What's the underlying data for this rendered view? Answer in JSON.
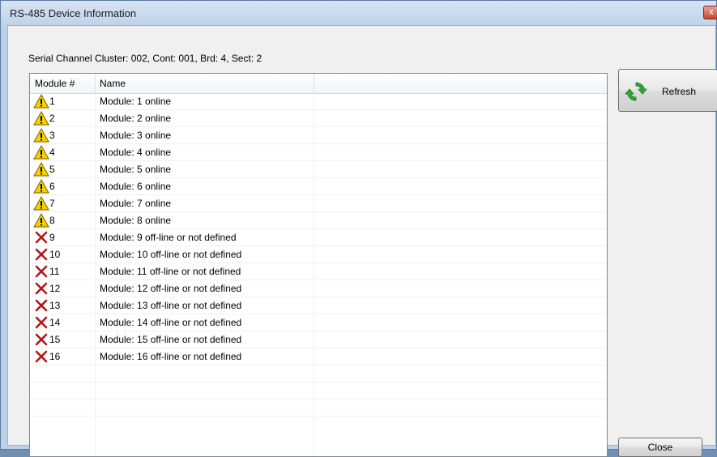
{
  "window": {
    "title": "RS-485 Device Information",
    "close_glyph": "x"
  },
  "info": {
    "label": "Serial Channel Cluster: 002, Cont: 001, Brd: 4, Sect: 2"
  },
  "table": {
    "columns": [
      "Module #",
      "Name"
    ],
    "rows": [
      {
        "status": "warning-icon",
        "num": "1",
        "name": "Module: 1 online"
      },
      {
        "status": "warning-icon",
        "num": "2",
        "name": "Module: 2 online"
      },
      {
        "status": "warning-icon",
        "num": "3",
        "name": "Module: 3 online"
      },
      {
        "status": "warning-icon",
        "num": "4",
        "name": "Module: 4 online"
      },
      {
        "status": "warning-icon",
        "num": "5",
        "name": "Module: 5 online"
      },
      {
        "status": "warning-icon",
        "num": "6",
        "name": "Module: 6 online"
      },
      {
        "status": "warning-icon",
        "num": "7",
        "name": "Module: 7 online"
      },
      {
        "status": "warning-icon",
        "num": "8",
        "name": "Module: 8 online"
      },
      {
        "status": "error-icon",
        "num": "9",
        "name": "Module: 9 off-line or not defined"
      },
      {
        "status": "error-icon",
        "num": "10",
        "name": "Module: 10 off-line or not defined"
      },
      {
        "status": "error-icon",
        "num": "11",
        "name": "Module: 11 off-line or not defined"
      },
      {
        "status": "error-icon",
        "num": "12",
        "name": "Module: 12 off-line or not defined"
      },
      {
        "status": "error-icon",
        "num": "13",
        "name": "Module: 13 off-line or not defined"
      },
      {
        "status": "error-icon",
        "num": "14",
        "name": "Module: 14 off-line or not defined"
      },
      {
        "status": "error-icon",
        "num": "15",
        "name": "Module: 15 off-line or not defined"
      },
      {
        "status": "error-icon",
        "num": "16",
        "name": "Module: 16 off-line or not defined"
      }
    ]
  },
  "buttons": {
    "refresh": "Refresh",
    "close": "Close"
  },
  "colors": {
    "warning": "#f5d000",
    "error": "#b01818",
    "refresh_green": "#2fa832"
  }
}
